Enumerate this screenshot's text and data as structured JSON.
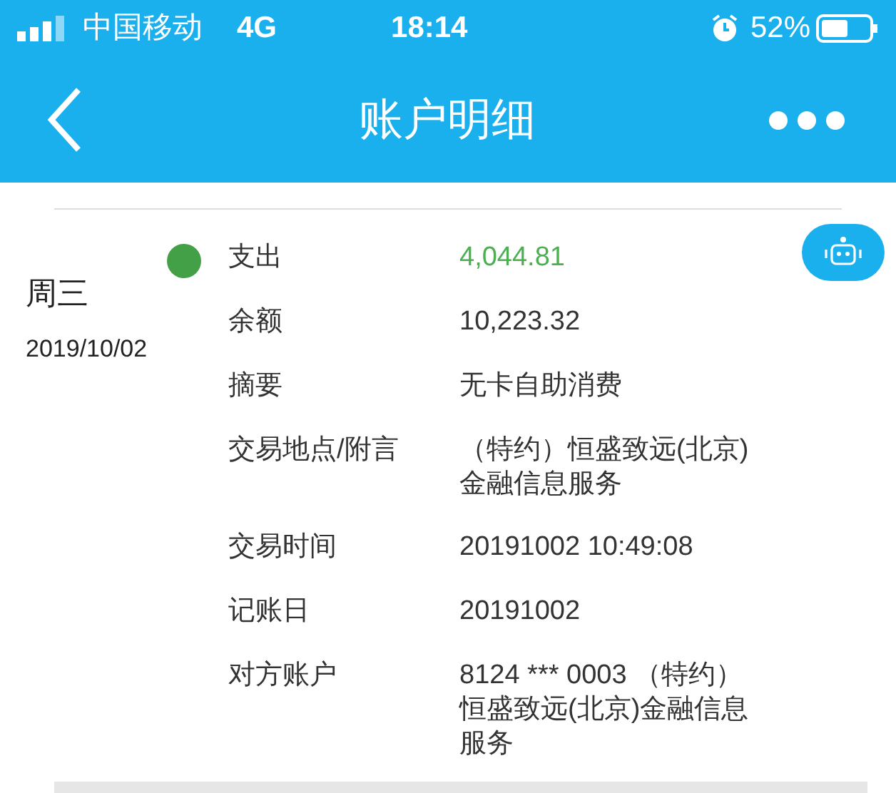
{
  "status_bar": {
    "carrier": "中国移动",
    "network": "4G",
    "time": "18:14",
    "battery": "52%"
  },
  "nav": {
    "title": "账户明细"
  },
  "record": {
    "weekday": "周三",
    "date": "2019/10/02",
    "color": "#43a047",
    "fields": [
      {
        "label": "支出",
        "lines": [
          "4,044.81"
        ],
        "color": "#4caf50"
      },
      {
        "label": "余额",
        "lines": [
          "10,223.32"
        ],
        "color": "#333333"
      },
      {
        "label": "摘要",
        "lines": [
          "无卡自助消费"
        ],
        "color": "#333333"
      },
      {
        "label": "交易地点/附言",
        "lines": [
          "（特约）恒盛致远(北京)",
          "金融信息服务"
        ],
        "color": "#333333"
      },
      {
        "label": "交易时间",
        "lines": [
          "20191002 10:49:08"
        ],
        "color": "#333333"
      },
      {
        "label": "记账日",
        "lines": [
          "20191002"
        ],
        "color": "#333333"
      },
      {
        "label": "对方账户",
        "lines": [
          "8124 *** 0003 （特约）",
          "恒盛致远(北京)金融信息",
          "服务"
        ],
        "color": "#333333"
      }
    ]
  }
}
